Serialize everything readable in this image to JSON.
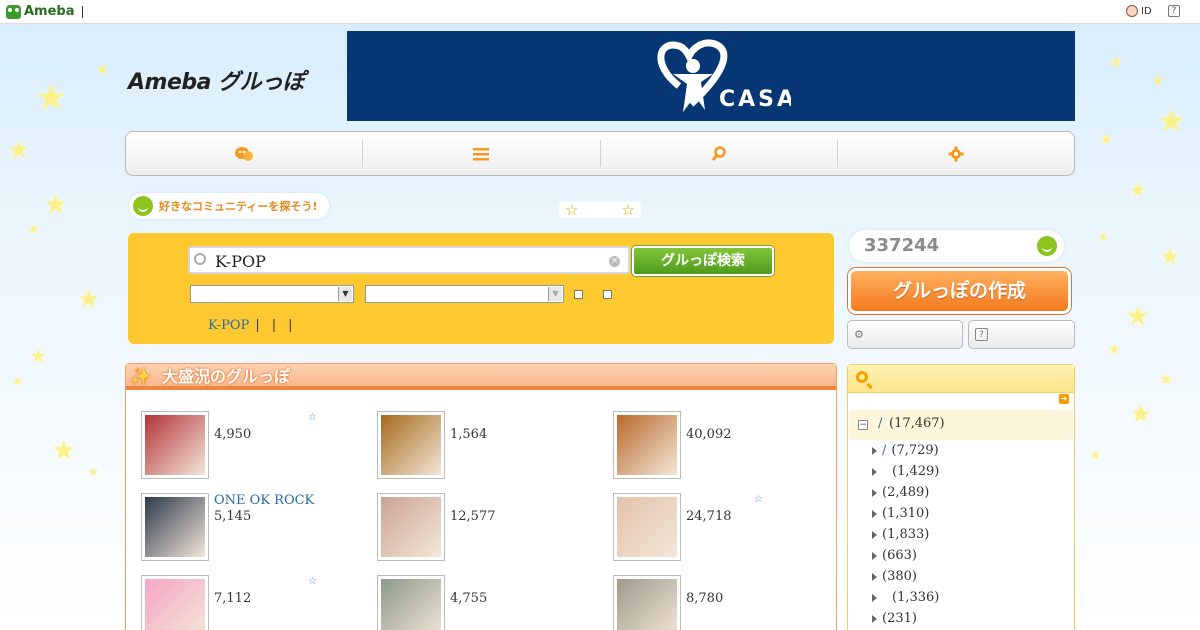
{
  "topbar": {
    "brand": "Ameba",
    "id_label": "ID",
    "help_label": "?"
  },
  "header": {
    "logo_text": "Ameba グルっぽ",
    "banner_text": "CASA"
  },
  "nav": {
    "items": [
      {
        "icon": "chat-bubble-icon"
      },
      {
        "icon": "menu-list-icon"
      },
      {
        "icon": "search-icon"
      },
      {
        "icon": "gear-icon"
      }
    ]
  },
  "hint": {
    "text": "好きなコミュニティーを探そう!"
  },
  "search": {
    "query": "K-POP",
    "clear_label": "×",
    "button_label": "グルっぽ検索",
    "links": [
      "K-POP",
      "|",
      "|",
      "|"
    ]
  },
  "popular": {
    "title": "大盛況のグルっぽ",
    "cards": [
      {
        "name": "",
        "count": "4,950",
        "thumb_color": "#b4343a",
        "fav": true
      },
      {
        "name": "",
        "count": "1,564",
        "thumb_color": "#a66a1b",
        "fav": false
      },
      {
        "name": "",
        "count": "40,092",
        "thumb_color": "#b96a2a",
        "fav": false
      },
      {
        "name": "ONE OK ROCK",
        "count": "5,145",
        "thumb_color": "#2c3a4c",
        "fav": false
      },
      {
        "name": "",
        "count": "12,577",
        "thumb_color": "#caa495",
        "fav": false
      },
      {
        "name": "",
        "count": "24,718",
        "thumb_color": "#e2c2aa",
        "fav": true
      },
      {
        "name": "",
        "count": "7,112",
        "thumb_color": "#f6a4c4",
        "fav": true
      },
      {
        "name": "",
        "count": "4,755",
        "thumb_color": "#8c9a8a",
        "fav": false
      },
      {
        "name": "",
        "count": "8,780",
        "thumb_color": "#a09a8c",
        "fav": false
      }
    ]
  },
  "sidebar": {
    "member_count": "337244",
    "create_label": "グルっぽの作成",
    "category_root": {
      "slash": "/",
      "count": "(17,467)"
    },
    "categories": [
      {
        "slash": "/",
        "count": "(7,729)"
      },
      {
        "slash": "",
        "count": "(1,429)"
      },
      {
        "slash": "",
        "count": "(2,489)"
      },
      {
        "slash": "",
        "count": "(1,310)"
      },
      {
        "slash": "",
        "count": "(1,833)"
      },
      {
        "slash": "",
        "count": "(663)"
      },
      {
        "slash": "",
        "count": "(380)"
      },
      {
        "slash": "",
        "count": "(1,336)"
      },
      {
        "slash": "",
        "count": "(231)"
      }
    ]
  }
}
